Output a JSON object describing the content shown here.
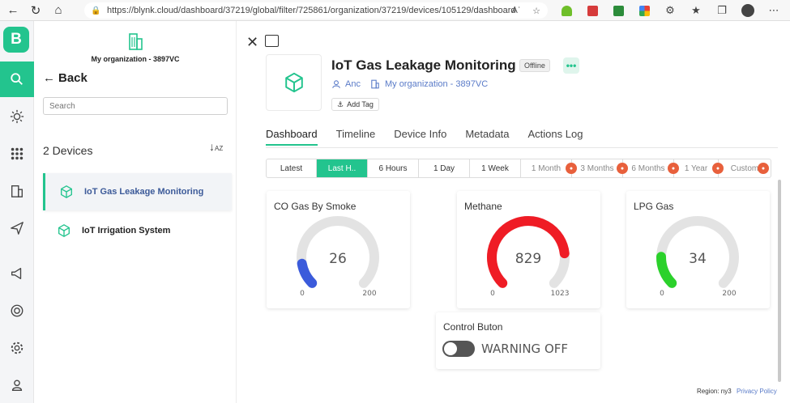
{
  "browser": {
    "url": "https://blynk.cloud/dashboard/37219/global/filter/725861/organization/37219/devices/105129/dashboard"
  },
  "colors": {
    "accent": "#23c48e",
    "smoke": "#3b5bdb",
    "methane": "#ef1c25",
    "lpg": "#2bd12b",
    "link": "#5a7bc8"
  },
  "rail": {
    "logo": "B",
    "items": [
      "search-icon",
      "sun-icon",
      "grid-icon",
      "building-icon",
      "send-icon",
      "megaphone-icon",
      "lifebuoy-icon",
      "gear-icon",
      "user-icon"
    ]
  },
  "sidebar": {
    "org_name": "My organization - 3897VC",
    "back_label": "Back",
    "search_placeholder": "Search",
    "device_count": "2 Devices",
    "devices": [
      {
        "name": "IoT Gas Leakage Monitoring",
        "active": true
      },
      {
        "name": "IoT Irrigation System",
        "active": false
      }
    ]
  },
  "device": {
    "title": "IoT Gas Leakage Monitoring",
    "status": "Offline",
    "owner": "Anc",
    "organization": "My organization - 3897VC",
    "add_tag": "Add Tag"
  },
  "tabs": [
    {
      "label": "Dashboard",
      "active": true
    },
    {
      "label": "Timeline"
    },
    {
      "label": "Device Info"
    },
    {
      "label": "Metadata"
    },
    {
      "label": "Actions Log"
    }
  ],
  "time_ranges": [
    {
      "label": "Latest"
    },
    {
      "label": "Last H..",
      "active": true
    },
    {
      "label": "6 Hours"
    },
    {
      "label": "1 Day"
    },
    {
      "label": "1 Week"
    },
    {
      "label": "1 Month",
      "locked": true
    },
    {
      "label": "3 Months",
      "locked": true
    },
    {
      "label": "6 Months",
      "locked": true
    },
    {
      "label": "1 Year",
      "locked": true
    },
    {
      "label": "Custom",
      "locked": true
    }
  ],
  "widgets": {
    "smoke": {
      "title": "CO Gas By Smoke",
      "value": 26,
      "min": 0,
      "max": 200
    },
    "methane": {
      "title": "Methane",
      "value": 829,
      "min": 0,
      "max": 1023
    },
    "lpg": {
      "title": "LPG Gas",
      "value": 34,
      "min": 0,
      "max": 200
    },
    "control": {
      "title": "Control Buton",
      "state_label": "WARNING OFF"
    }
  },
  "footer": {
    "region": "Region: ny3",
    "privacy": "Privacy Policy"
  }
}
